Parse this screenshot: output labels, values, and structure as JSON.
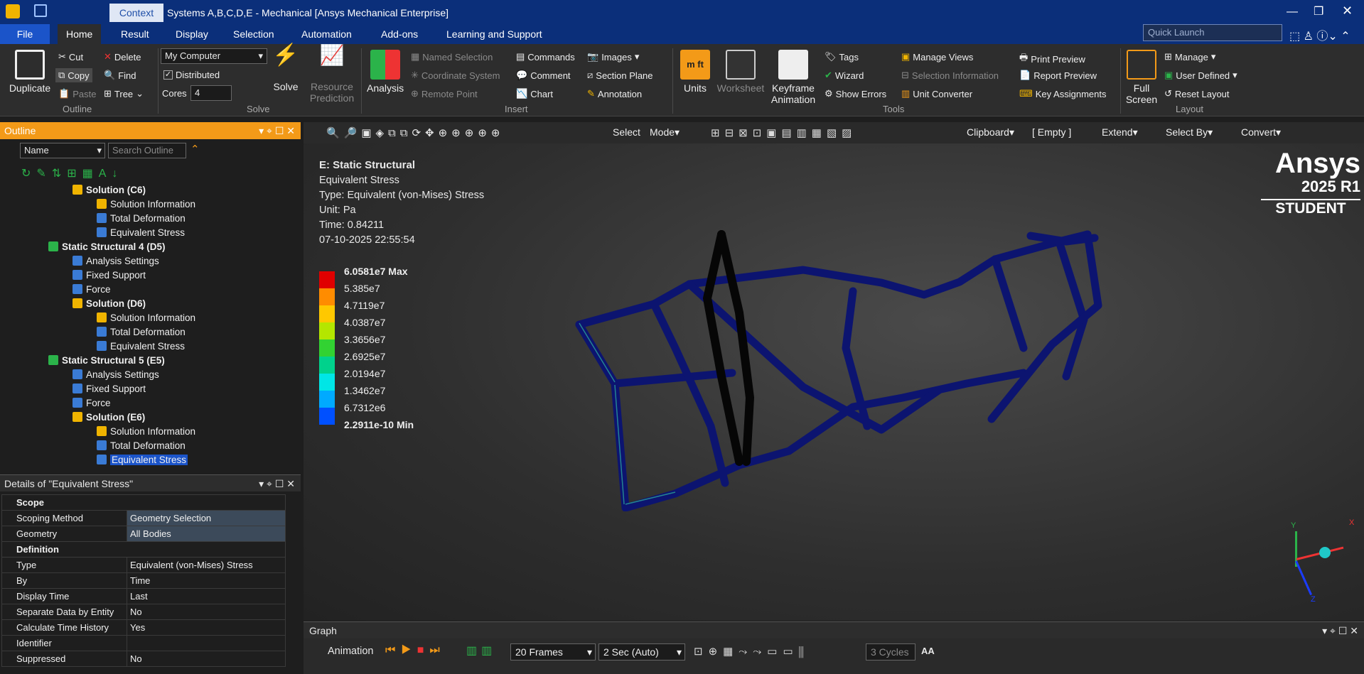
{
  "window": {
    "title": "Systems A,B,C,D,E - Mechanical [Ansys Mechanical Enterprise]",
    "context_tab": "Context"
  },
  "tabs": [
    "File",
    "Home",
    "Result",
    "Display",
    "Selection",
    "Automation",
    "Add-ons",
    "Learning and Support"
  ],
  "quick_launch": {
    "placeholder": "Quick Launch"
  },
  "ribbon": {
    "outline": {
      "duplicate": "Duplicate",
      "cut": "Cut",
      "copy": "Copy",
      "paste": "Paste",
      "delete": "Delete",
      "find": "Find",
      "tree": "Tree",
      "label": "Outline"
    },
    "solve": {
      "computer": "My Computer",
      "distributed": "Distributed",
      "cores_label": "Cores",
      "cores": "4",
      "solve": "Solve",
      "resource_prediction": "Resource Prediction",
      "label": "Solve"
    },
    "insert": {
      "analysis": "Analysis",
      "named_selection": "Named Selection",
      "coordinate_system": "Coordinate System",
      "remote_point": "Remote Point",
      "commands": "Commands",
      "comment": "Comment",
      "chart": "Chart",
      "images": "Images",
      "section_plane": "Section Plane",
      "annotation": "Annotation",
      "label": "Insert"
    },
    "tools": {
      "units": "Units",
      "worksheet": "Worksheet",
      "keyframe": "Keyframe Animation",
      "tags": "Tags",
      "wizard": "Wizard",
      "show_errors": "Show Errors",
      "manage_views": "Manage Views",
      "selection_information": "Selection Information",
      "unit_converter": "Unit Converter",
      "print_preview": "Print Preview",
      "report_preview": "Report Preview",
      "key_assignments": "Key Assignments",
      "label": "Tools"
    },
    "layout": {
      "full_screen": "Full Screen",
      "manage": "Manage",
      "user_defined": "User Defined",
      "reset_layout": "Reset Layout",
      "label": "Layout"
    }
  },
  "outline": {
    "title": "Outline",
    "filter": "Name",
    "search_placeholder": "Search Outline",
    "items": [
      {
        "label": "Solution (C6)",
        "bold": true
      },
      {
        "label": "Solution Information"
      },
      {
        "label": "Total Deformation"
      },
      {
        "label": "Equivalent Stress"
      },
      {
        "label": "Static Structural 4 (D5)",
        "bold": true
      },
      {
        "label": "Analysis Settings"
      },
      {
        "label": "Fixed Support"
      },
      {
        "label": "Force"
      },
      {
        "label": "Solution (D6)",
        "bold": true
      },
      {
        "label": "Solution Information"
      },
      {
        "label": "Total Deformation"
      },
      {
        "label": "Equivalent Stress"
      },
      {
        "label": "Static Structural 5 (E5)",
        "bold": true
      },
      {
        "label": "Analysis Settings"
      },
      {
        "label": "Fixed Support"
      },
      {
        "label": "Force"
      },
      {
        "label": "Solution (E6)",
        "bold": true
      },
      {
        "label": "Solution Information"
      },
      {
        "label": "Total Deformation"
      },
      {
        "label": "Equivalent Stress",
        "selected": true
      }
    ]
  },
  "details": {
    "title": "Details of \"Equivalent Stress\"",
    "rows": [
      {
        "section": "Scope"
      },
      {
        "k": "Scoping Method",
        "v": "Geometry Selection"
      },
      {
        "k": "Geometry",
        "v": "All Bodies"
      },
      {
        "section": "Definition"
      },
      {
        "k": "Type",
        "v": "Equivalent (von-Mises) Stress"
      },
      {
        "k": "By",
        "v": "Time"
      },
      {
        "k": "Display Time",
        "v": "Last"
      },
      {
        "k": "Separate Data by Entity",
        "v": "No"
      },
      {
        "k": "Calculate Time History",
        "v": "Yes"
      },
      {
        "k": "Identifier",
        "v": ""
      },
      {
        "k": "Suppressed",
        "v": "No"
      }
    ]
  },
  "viewport": {
    "toolbar": {
      "select": "Select",
      "mode": "Mode",
      "clipboard": "Clipboard",
      "empty": "[ Empty ]",
      "extend": "Extend",
      "select_by": "Select By",
      "convert": "Convert"
    },
    "info": {
      "title": "E: Static Structural",
      "line1": "Equivalent Stress",
      "line2": "Type: Equivalent (von-Mises) Stress",
      "line3": "Unit: Pa",
      "line4": "Time: 0.84211",
      "line5": "07-10-2025 22:55:54"
    },
    "legend": [
      "6.0581e7 Max",
      "5.385e7",
      "4.7119e7",
      "4.0387e7",
      "3.3656e7",
      "2.6925e7",
      "2.0194e7",
      "1.3462e7",
      "6.7312e6",
      "2.2911e-10 Min"
    ],
    "legend_colors": [
      "#e00000",
      "#ff8c00",
      "#ffc800",
      "#b4e600",
      "#32d232",
      "#00d28c",
      "#00e6e6",
      "#00aaff",
      "#0050ff",
      "#0000c8"
    ],
    "brand": {
      "name": "Ansys",
      "version": "2025 R1",
      "edition": "STUDENT"
    },
    "axes": {
      "x": "X",
      "y": "Y",
      "z": "Z"
    }
  },
  "graph": {
    "title": "Graph",
    "animation": "Animation",
    "frames": "20 Frames",
    "duration": "2 Sec (Auto)",
    "cycles": "3 Cycles",
    "aa": "AA"
  }
}
